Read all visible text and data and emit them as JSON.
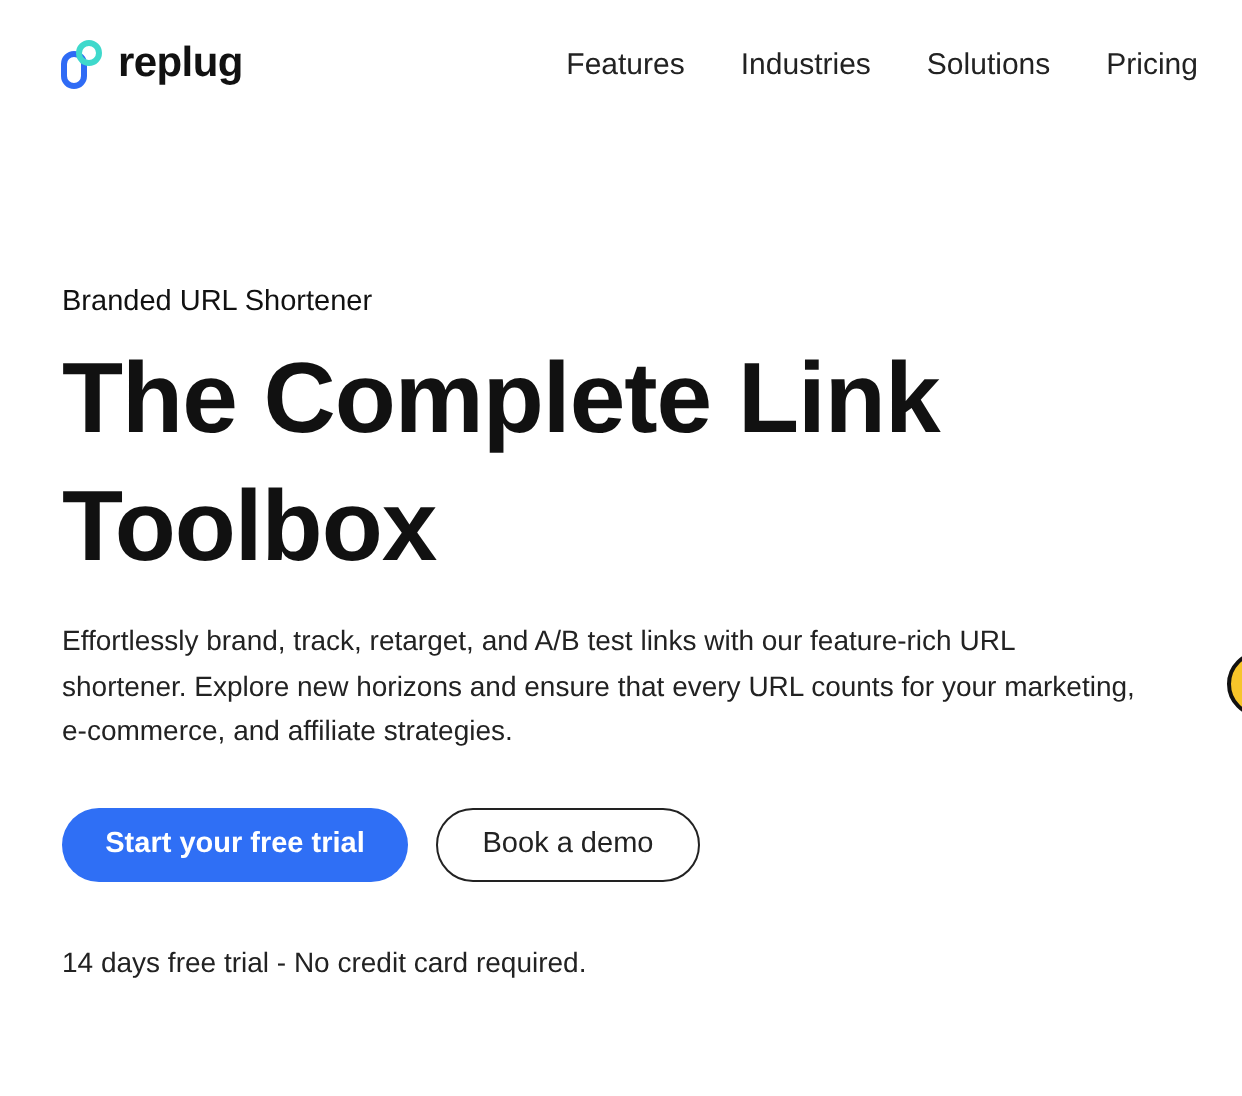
{
  "brand": {
    "name": "replug"
  },
  "nav": [
    {
      "label": "Features"
    },
    {
      "label": "Industries"
    },
    {
      "label": "Solutions"
    },
    {
      "label": "Pricing"
    }
  ],
  "hero": {
    "eyebrow": "Branded URL Shortener",
    "title": "The Complete Link Toolbox",
    "description": "Effortlessly brand, track, retarget, and A/B test links with our feature-rich URL shortener. Explore new horizons and ensure that every URL counts for your marketing, e-commerce, and affiliate strategies.",
    "buttons": [
      {
        "label": "Start your free trial",
        "kind": "primary"
      },
      {
        "label": "Book a demo",
        "kind": "secondary"
      }
    ],
    "note": "14 days free trial - No credit card required."
  }
}
